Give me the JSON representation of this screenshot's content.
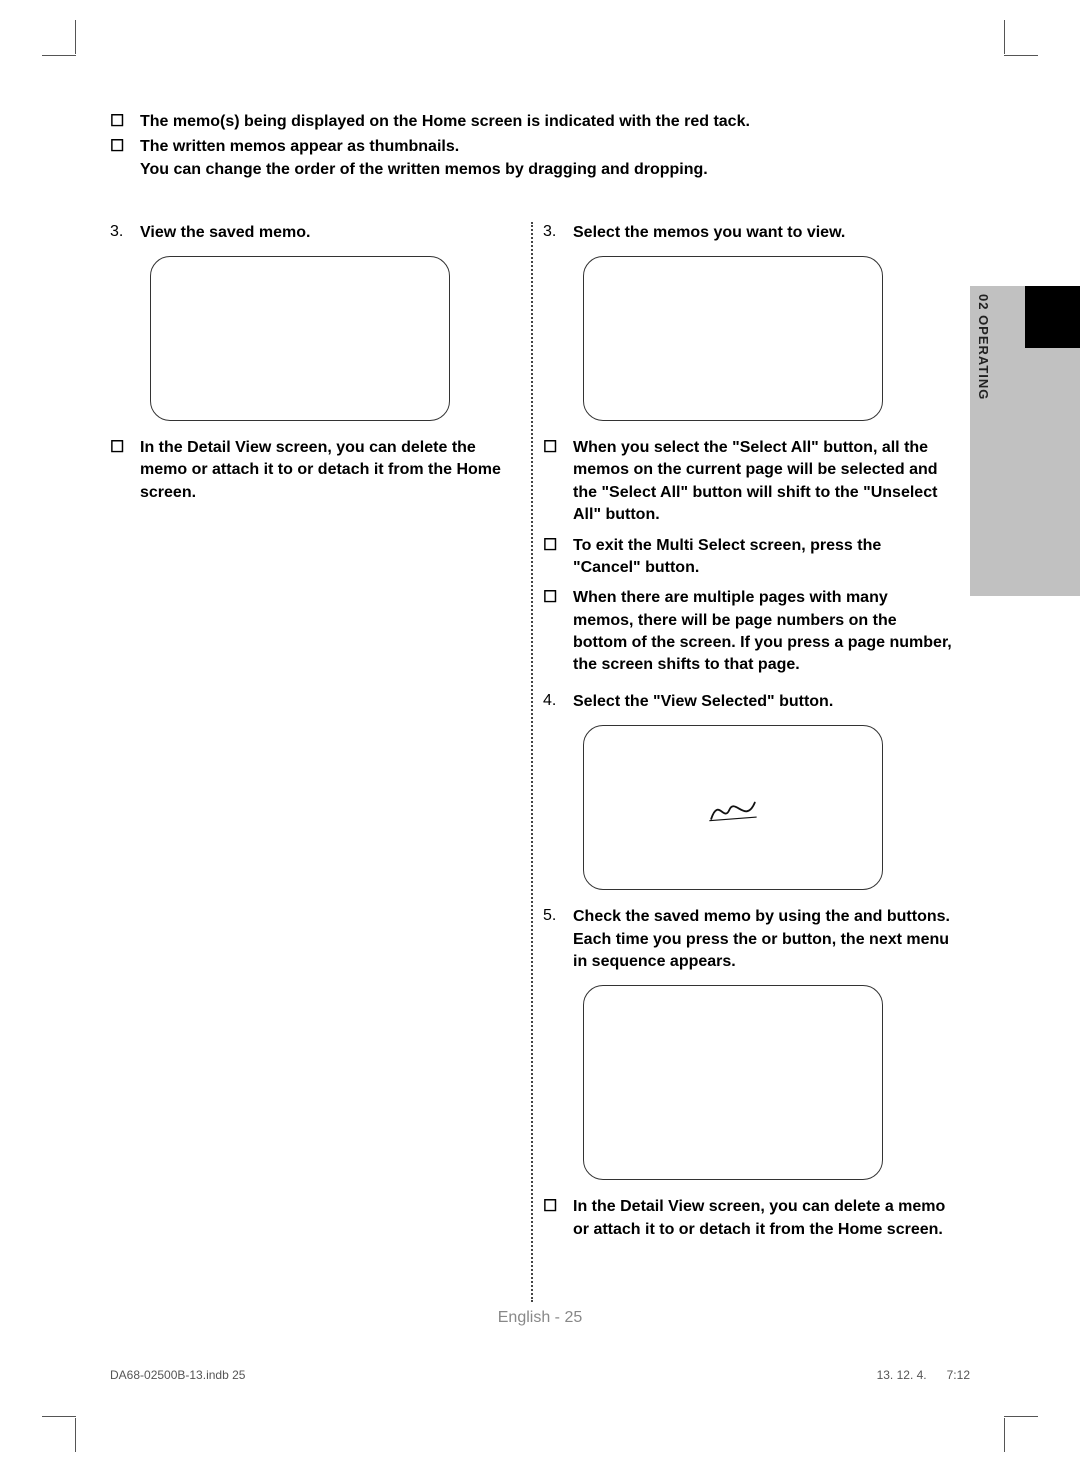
{
  "tips": [
    "The memo(s) being displayed on the Home screen is indicated with the red tack.",
    "The written memos appear as thumbnails.\nYou can change the order of the written memos by dragging and dropping."
  ],
  "left": {
    "step3": {
      "num": "3.",
      "title": "View the saved memo."
    },
    "note1": "In the Detail View screen, you can delete the memo or attach it to or detach it from the Home screen."
  },
  "right": {
    "step3": {
      "num": "3.",
      "title": "Select the memos you want to view."
    },
    "note1": "When you select the \"Select All\" button, all the memos on the current page will be selected and the \"Select All\" button will shift to the \"Unselect All\" button.",
    "note2": "To exit the Multi Select screen, press the \"Cancel\" button.",
    "note3": "When there are multiple pages with many memos, there will be page numbers on the bottom of the screen. If you press a page number, the screen shifts to that page.",
    "step4": {
      "num": "4.",
      "title": "Select the \"View Selected\" button."
    },
    "step5": {
      "num": "5.",
      "title": "Check the saved memo by using the  and  buttons. Each time you press the  or  button, the next menu in sequence appears."
    },
    "note4": "In the Detail View screen, you can delete a memo or attach it to or detach it from the Home screen."
  },
  "section_tab": "02  OPERATING",
  "page_footer": "English - 25",
  "print_left": "DA68-02500B-13.indb   25",
  "print_right": "13. 12. 4.      7:12",
  "bullet_marker": "☐"
}
